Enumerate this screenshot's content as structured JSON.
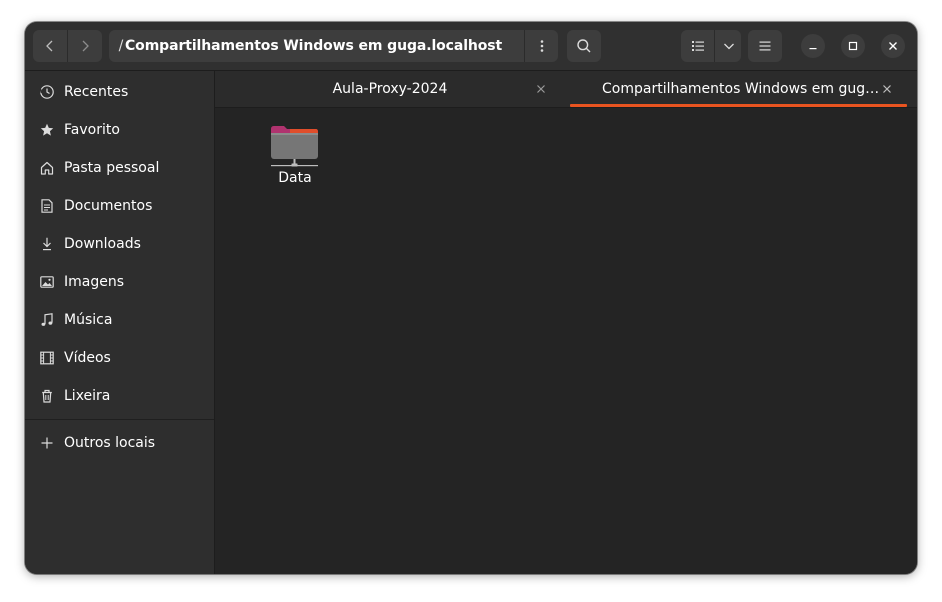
{
  "headerbar": {
    "path_separator": "/",
    "path_current": "Compartilhamentos Windows em guga.localhost"
  },
  "sidebar": {
    "items": [
      {
        "label": "Recentes",
        "icon": "clock-icon"
      },
      {
        "label": "Favorito",
        "icon": "star-icon"
      },
      {
        "label": "Pasta pessoal",
        "icon": "home-icon"
      },
      {
        "label": "Documentos",
        "icon": "document-icon"
      },
      {
        "label": "Downloads",
        "icon": "download-icon"
      },
      {
        "label": "Imagens",
        "icon": "image-icon"
      },
      {
        "label": "Música",
        "icon": "music-icon"
      },
      {
        "label": "Vídeos",
        "icon": "film-icon"
      },
      {
        "label": "Lixeira",
        "icon": "trash-icon"
      }
    ],
    "other_locations": {
      "label": "Outros locais",
      "icon": "plus-icon"
    }
  },
  "tabs": [
    {
      "label": "Aula-Proxy-2024",
      "active": false
    },
    {
      "label": "Compartilhamentos Windows em gug…",
      "active": true
    }
  ],
  "files": [
    {
      "name": "Data",
      "icon": "network-folder-icon"
    }
  ],
  "colors": {
    "accent": "#e95420",
    "window_bg": "#242424",
    "sidebar_bg": "#2e2e2e",
    "headerbar_bg": "#303030",
    "folder_tab": "#b0336f",
    "folder_body": "#767676"
  }
}
